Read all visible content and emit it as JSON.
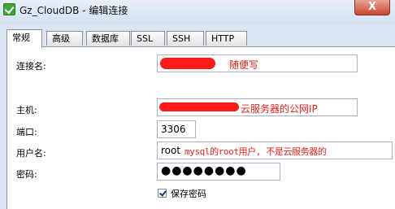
{
  "window": {
    "app_name": "Gz_CloudDB",
    "separator": " - ",
    "title": "编辑连接",
    "close_label": "X"
  },
  "tabs": [
    {
      "label": "常规",
      "active": true
    },
    {
      "label": "高级",
      "active": false
    },
    {
      "label": "数据库",
      "active": false
    },
    {
      "label": "SSL",
      "active": false
    },
    {
      "label": "SSH",
      "active": false
    },
    {
      "label": "HTTP",
      "active": false
    }
  ],
  "form": {
    "connection_name_label": "连接名:",
    "connection_name_note": "随便写",
    "host_label": "主机:",
    "host_note": "云服务器的公网IP",
    "port_label": "端口:",
    "port_value": "3306",
    "username_label": "用户名:",
    "username_value": "root",
    "username_note": "mysql的root用户, 不是云服务器的",
    "password_label": "密码:",
    "password_masked": "●●●●●●●●",
    "save_password_label": "保存密码",
    "save_password_checked": true
  },
  "colors": {
    "annotation_red": "#e0231c",
    "redaction_red": "#ff1a1a"
  }
}
